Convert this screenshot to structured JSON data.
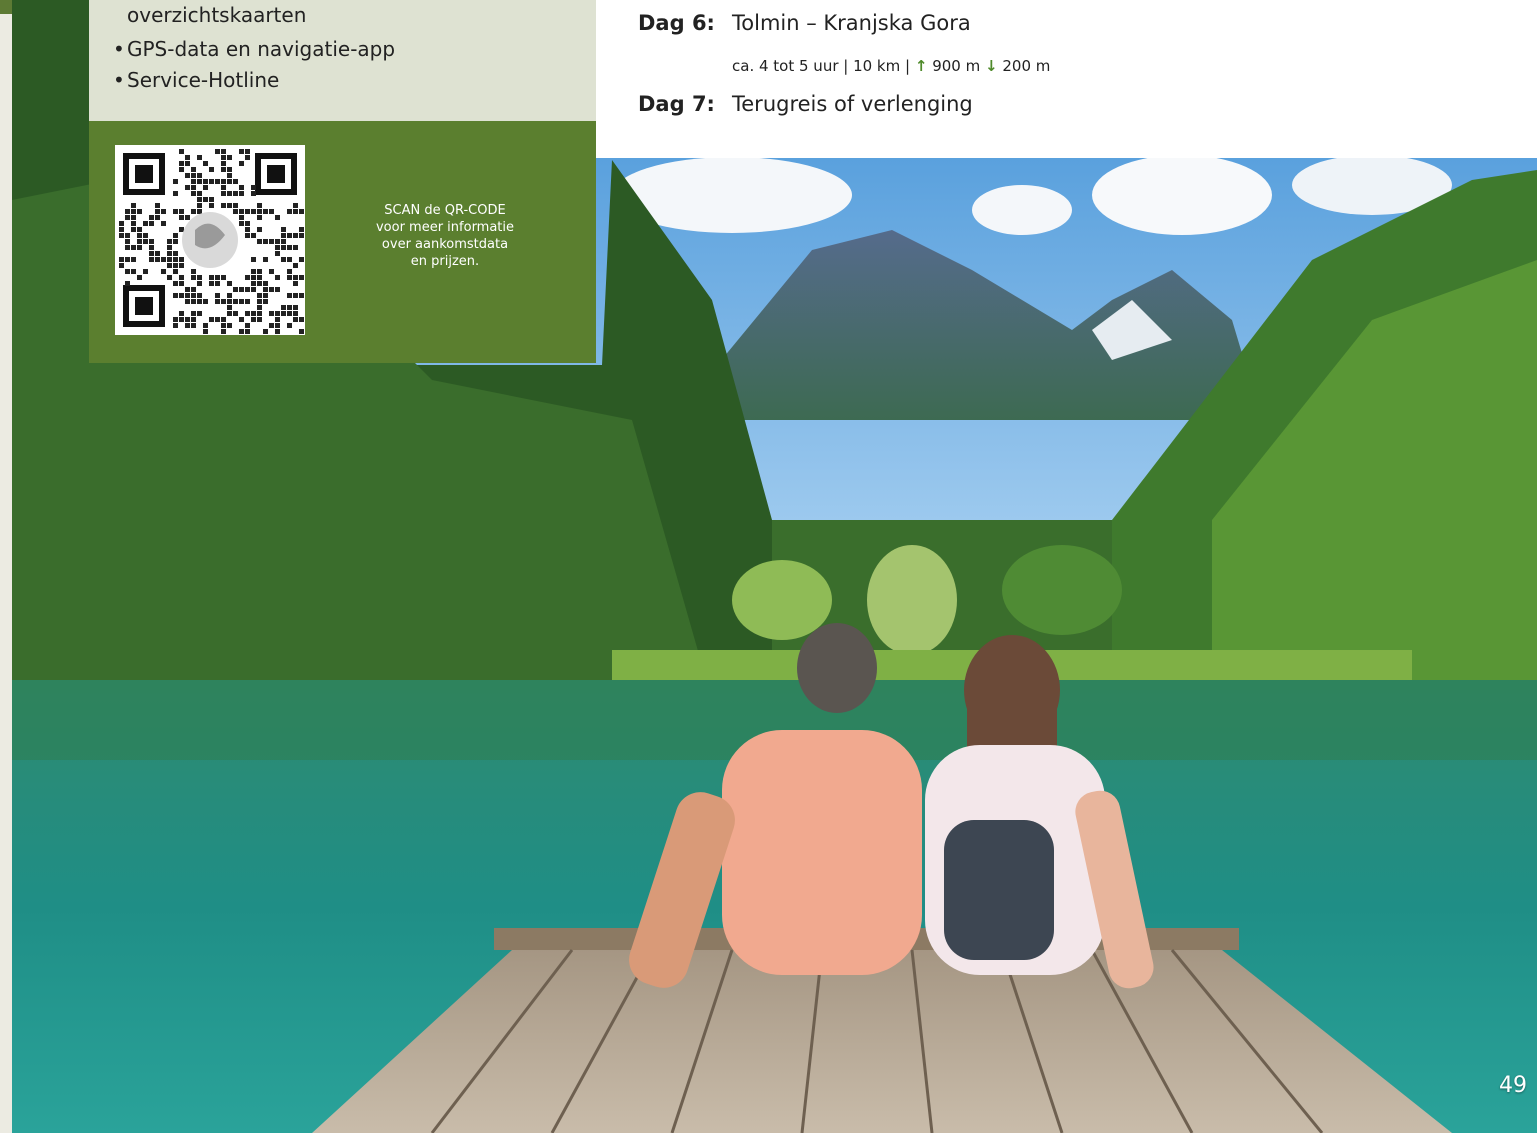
{
  "features": {
    "continued_line": "overzichtskaarten",
    "items": [
      {
        "bullet": "•",
        "label": "GPS-data en navigatie-app"
      },
      {
        "bullet": "•",
        "label": "Service-Hotline"
      }
    ]
  },
  "qr": {
    "caption_lines": [
      "SCAN de QR-CODE",
      "voor meer informatie",
      "over aankomstdata",
      "en prijzen."
    ]
  },
  "itinerary": {
    "day6": {
      "label": "Dag 6:",
      "title": "Tolmin – Kranjska Gora"
    },
    "day6_stats": {
      "prefix": "ca. 4 tot 5 uur | 10 km |",
      "up_icon": "↑",
      "ascent": "900 m",
      "down_icon": "↓",
      "descent": "200 m"
    },
    "day7": {
      "label": "Dag 7:",
      "title": "Terugreis of verlenging"
    }
  },
  "page_number": "49",
  "colors": {
    "accent_green": "#5b7f2f",
    "panel_beige": "#dee2d2",
    "arrow_green": "#4f8a2b"
  },
  "photo": {
    "icon": "photo-lake-mountains-couple-on-dock"
  }
}
